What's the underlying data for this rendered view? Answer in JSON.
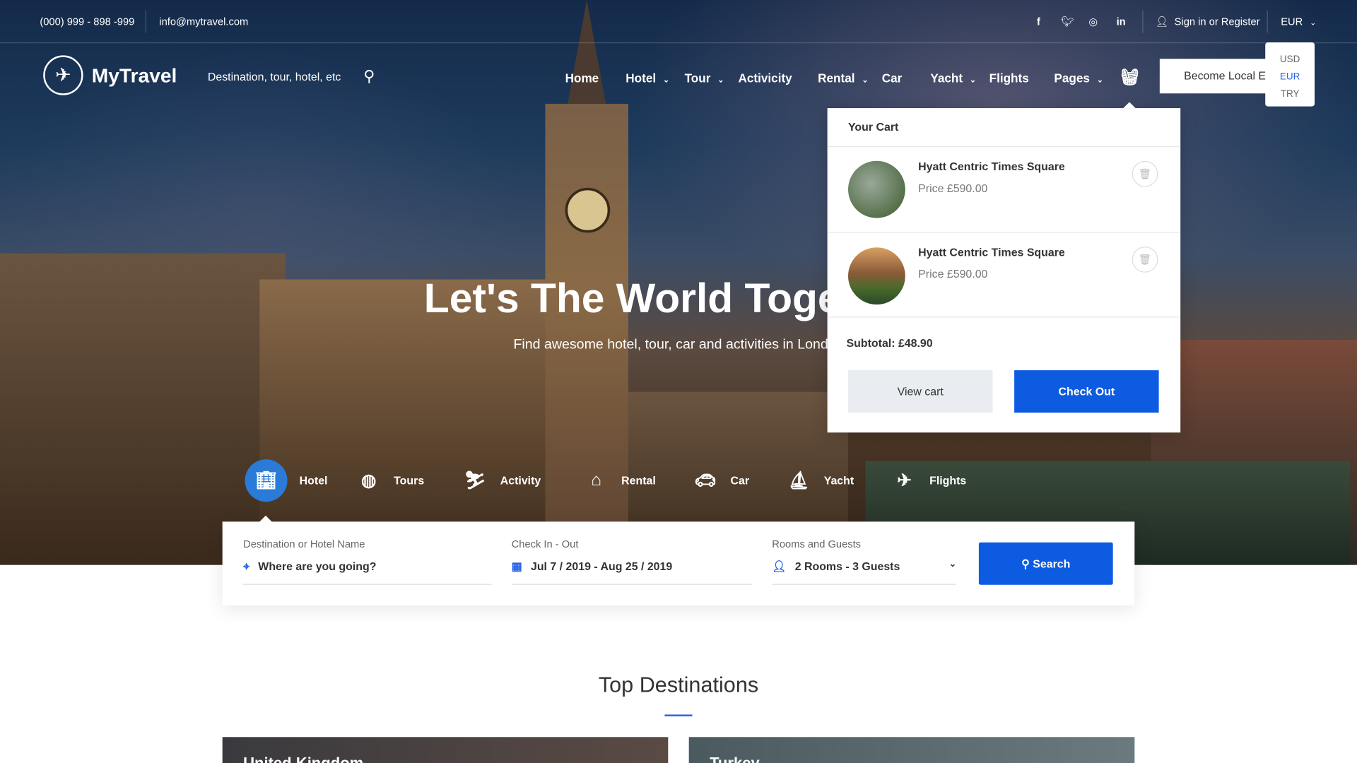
{
  "topbar": {
    "phone": "(000) 999 - 898 -999",
    "email": "info@mytravel.com",
    "signin": "Sign in or Register",
    "currency": "EUR"
  },
  "currency_options": [
    "USD",
    "EUR",
    "TRY"
  ],
  "brand": "MyTravel",
  "search_placeholder": "Destination, tour, hotel, etc",
  "nav": [
    "Home",
    "Hotel",
    "Tour",
    "Activicity",
    "Rental",
    "Car",
    "Yacht",
    "Flights",
    "Pages"
  ],
  "become_local": "Become Local Expert",
  "cart": {
    "title": "Your Cart",
    "items": [
      {
        "name": "Hyatt Centric Times  Square",
        "price": "Price  £590.00"
      },
      {
        "name": "Hyatt Centric Times  Square",
        "price": "Price  £590.00"
      }
    ],
    "subtotal": "Subtotal: £48.90",
    "view": "View cart",
    "checkout": "Check Out"
  },
  "hero": {
    "title": "Let's The World Together!",
    "subtitle": "Find awesome hotel, tour, car and activities in London"
  },
  "tabs": [
    "Hotel",
    "Tours",
    "Activity",
    "Rental",
    "Car",
    "Yacht",
    "Flights"
  ],
  "search": {
    "dest_label": "Destination or Hotel Name",
    "dest_value": "Where are you going?",
    "date_label": "Check In - Out",
    "date_value": "Jul 7 / 2019 - Aug 25 / 2019",
    "rooms_label": "Rooms and Guests",
    "rooms_value": "2 Rooms - 3 Guests",
    "button": "Search"
  },
  "section_title": "Top Destinations",
  "cards": [
    "United Kingdom",
    "Turkey"
  ],
  "colors": {
    "accent": "#0d5be1"
  }
}
